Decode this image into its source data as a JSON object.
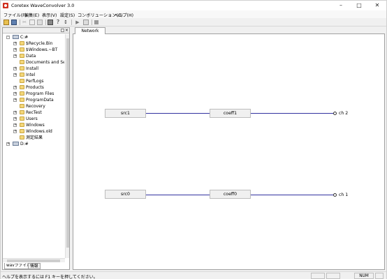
{
  "window": {
    "title": "Coretex WaveConvolver 3.0"
  },
  "menu": [
    "ファイル(F)",
    "編集(E)",
    "表示(V)",
    "設定(S)",
    "コンボリューション(C)",
    "ヘルプ(H)"
  ],
  "tree": {
    "items": [
      {
        "label": "C:#",
        "kind": "drive",
        "level": 0,
        "expander": "-"
      },
      {
        "label": "$Recycle.Bin",
        "kind": "folder",
        "level": 1,
        "expander": "+"
      },
      {
        "label": "$Windows.~BT",
        "kind": "folder",
        "level": 1,
        "expander": "+"
      },
      {
        "label": "Data",
        "kind": "folder",
        "level": 1,
        "expander": "+"
      },
      {
        "label": "Documents and Settings",
        "kind": "folder",
        "level": 1,
        "expander": ""
      },
      {
        "label": "Install",
        "kind": "folder",
        "level": 1,
        "expander": "+"
      },
      {
        "label": "Intel",
        "kind": "folder",
        "level": 1,
        "expander": "+"
      },
      {
        "label": "PerfLogs",
        "kind": "folder",
        "level": 1,
        "expander": ""
      },
      {
        "label": "Products",
        "kind": "folder",
        "level": 1,
        "expander": "+"
      },
      {
        "label": "Program Files",
        "kind": "folder",
        "level": 1,
        "expander": "+"
      },
      {
        "label": "ProgramData",
        "kind": "folder",
        "level": 1,
        "expander": "+"
      },
      {
        "label": "Recovery",
        "kind": "folder",
        "level": 1,
        "expander": ""
      },
      {
        "label": "RecTest",
        "kind": "folder",
        "level": 1,
        "expander": "+"
      },
      {
        "label": "Users",
        "kind": "folder",
        "level": 1,
        "expander": "+"
      },
      {
        "label": "Windows",
        "kind": "folder",
        "level": 1,
        "expander": "+"
      },
      {
        "label": "Windows.old",
        "kind": "folder",
        "level": 1,
        "expander": "+"
      },
      {
        "label": "測定結果",
        "kind": "folder",
        "level": 1,
        "expander": ""
      },
      {
        "label": "D:#",
        "kind": "drive",
        "level": 0,
        "expander": "+"
      }
    ]
  },
  "left_tabs": [
    "wavファイル",
    "情報"
  ],
  "main_tab": "Network",
  "network": {
    "rows": [
      {
        "src": "src1",
        "coeff": "coeff1",
        "out": "ch 2"
      },
      {
        "src": "src0",
        "coeff": "coeff0",
        "out": "ch 1"
      }
    ]
  },
  "status": {
    "help": "ヘルプを表示するには F1 キーを押してください。",
    "num": "NUM"
  },
  "colors": {
    "wire": "#3030a0",
    "app_icon": "#d03020"
  }
}
